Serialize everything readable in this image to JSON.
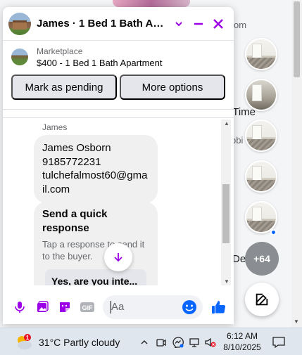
{
  "background": {
    "snippets": [
      "om",
      "d Time",
      "obi",
      "Dele"
    ],
    "more_count": "+64"
  },
  "chat": {
    "title": "James · 1 Bed 1 Bath Apart...",
    "listing": {
      "label": "Marketplace",
      "price_title": "$400 - 1 Bed 1 Bath Apartment"
    },
    "actions": {
      "mark_pending": "Mark as pending",
      "more_options": "More options"
    },
    "message": {
      "sender": "James",
      "lines": [
        "James Osborn",
        "9185772231",
        "tulchefalmost60@gmail.com"
      ]
    },
    "quick_response": {
      "title": "Send a quick response",
      "subtitle": "Tap a response to send it to the buyer.",
      "option": "Yes, are you inte..."
    },
    "composer": {
      "placeholder": "Aa"
    },
    "colors": {
      "accent": "#9b00e6",
      "messenger_blue": "#0866ff"
    }
  },
  "taskbar": {
    "weather": "31°C  Partly cloudy",
    "weather_badge": "1",
    "time": "6:12 AM",
    "date": "8/10/2025"
  }
}
